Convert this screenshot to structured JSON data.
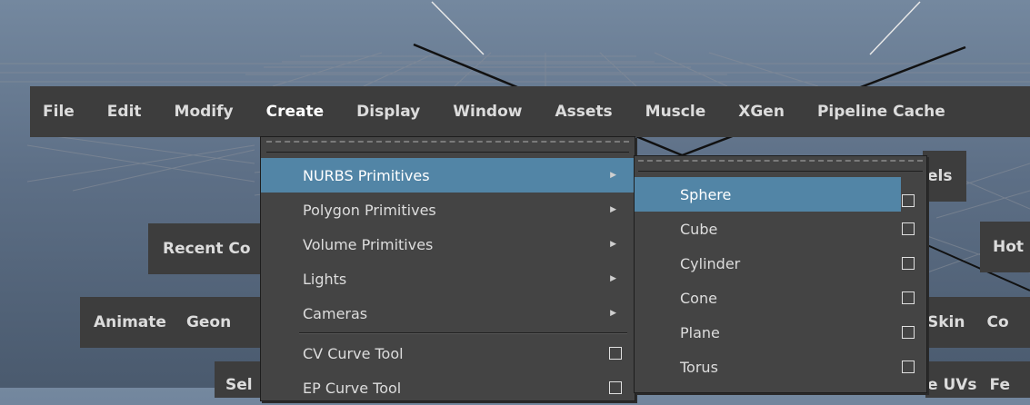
{
  "colors": {
    "viewport_top": "#74889f",
    "viewport_bottom": "#4a5a6e",
    "menu_bg": "#444444",
    "bar_bg": "#3d3d3d",
    "highlight": "#5285a6",
    "grid_line": "#8a8f99"
  },
  "menubar": {
    "items": [
      "File",
      "Edit",
      "Modify",
      "Create",
      "Display",
      "Window",
      "Assets",
      "Muscle",
      "XGen",
      "Pipeline Cache"
    ]
  },
  "hotbox": {
    "recent": "Recent Co",
    "animate": "Animate",
    "geom": "Geon",
    "els": "els",
    "hot": "Hot",
    "skin": "Skin",
    "con": "Co",
    "sel": "Sel",
    "uvs": "e UVs",
    "fe": "Fe"
  },
  "create_menu": {
    "items": [
      {
        "label": "NURBS Primitives",
        "icon": "submenu-arrow-icon"
      },
      {
        "label": "Polygon Primitives",
        "icon": "submenu-arrow-icon"
      },
      {
        "label": "Volume Primitives",
        "icon": "submenu-arrow-icon"
      },
      {
        "label": "Lights",
        "icon": "submenu-arrow-icon"
      },
      {
        "label": "Cameras",
        "icon": "submenu-arrow-icon"
      },
      {
        "label": "CV Curve Tool",
        "icon": "option-box-icon"
      },
      {
        "label": "EP Curve Tool",
        "icon": "option-box-icon"
      }
    ],
    "highlighted": "NURBS Primitives"
  },
  "nurbs_submenu": {
    "items": [
      "Sphere",
      "Cube",
      "Cylinder",
      "Cone",
      "Plane",
      "Torus"
    ],
    "highlighted": "Sphere",
    "icon": "option-box-icon"
  }
}
